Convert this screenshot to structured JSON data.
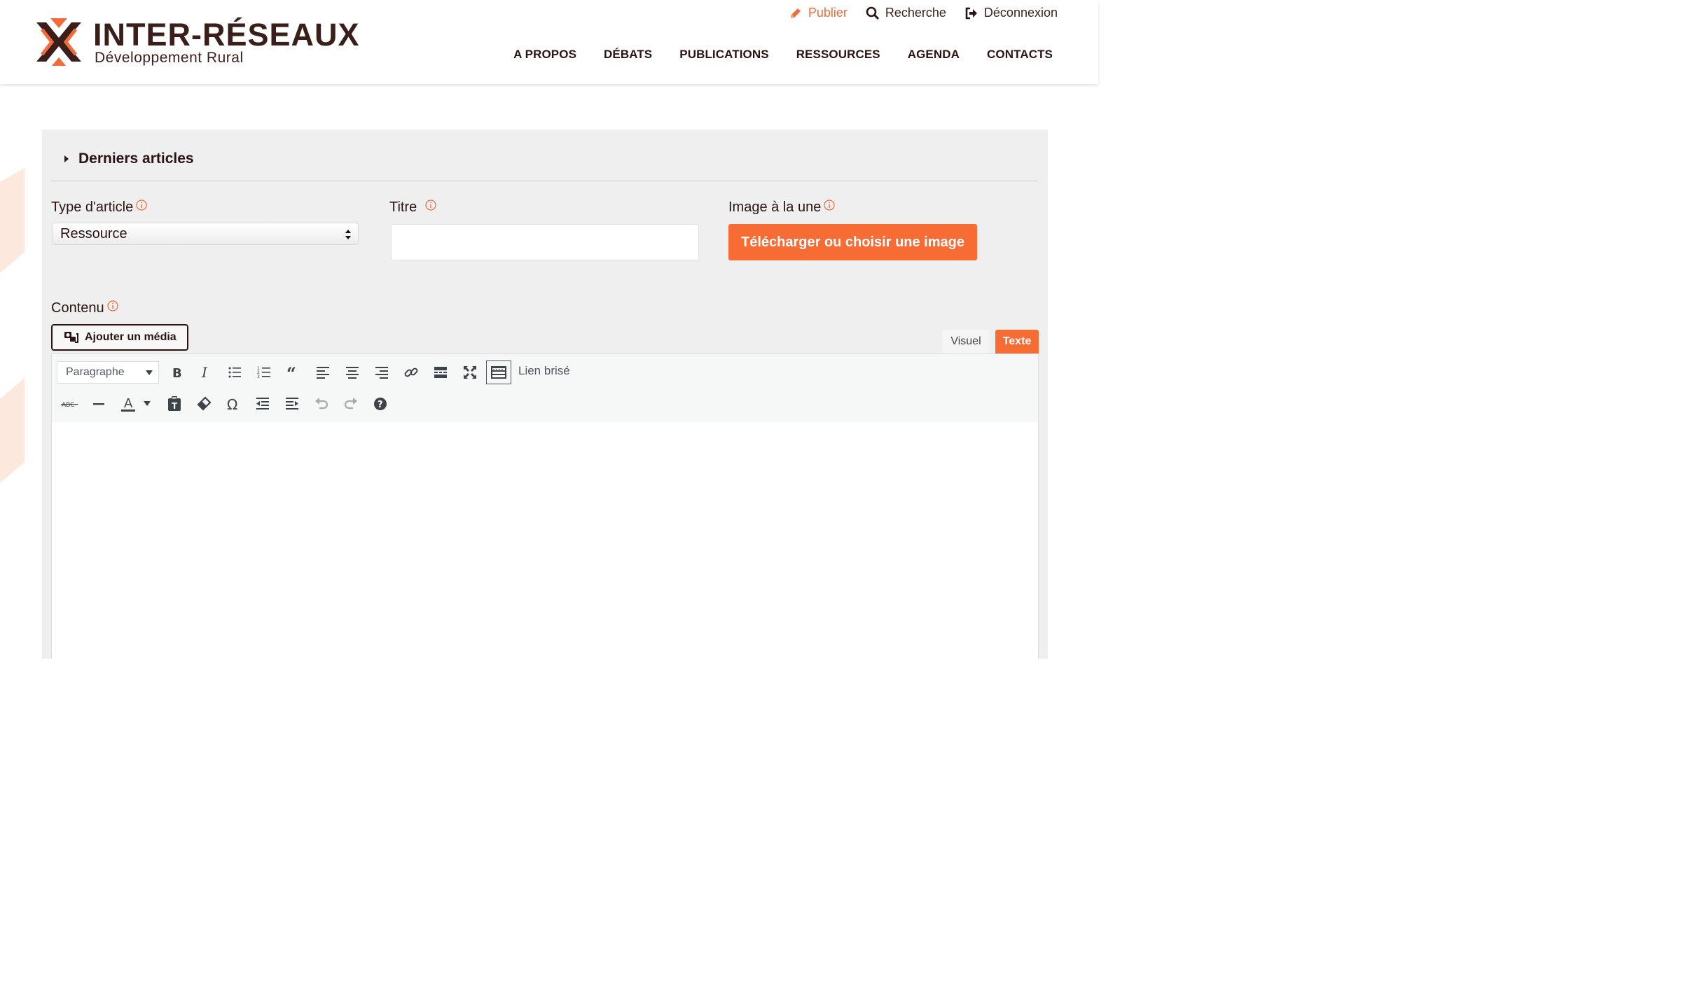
{
  "brand": {
    "title": "INTER-RÉSEAUX",
    "subtitle": "Développement Rural",
    "colors": {
      "accent": "#f76b35",
      "dark": "#3a1e19"
    }
  },
  "topbar": {
    "publish_label": "Publier",
    "search_label": "Recherche",
    "logout_label": "Déconnexion"
  },
  "nav": {
    "items": [
      {
        "label": "A PROPOS"
      },
      {
        "label": "DÉBATS"
      },
      {
        "label": "PUBLICATIONS"
      },
      {
        "label": "RESSOURCES"
      },
      {
        "label": "AGENDA"
      },
      {
        "label": "CONTACTS"
      }
    ]
  },
  "form": {
    "section_title": "Derniers articles",
    "type_label": "Type d'article",
    "type_value": "Ressource",
    "title_label": "Titre",
    "title_value": "",
    "image_label": "Image à la une",
    "upload_button": "Télécharger ou choisir une image",
    "content_label": "Contenu",
    "add_media_button": "Ajouter un média"
  },
  "editor": {
    "tabs": {
      "visual": "Visuel",
      "text": "Texte",
      "active": "text"
    },
    "format_select": "Paragraphe",
    "broken_link_label": "Lien brisé",
    "toolbar_row1_icons": [
      "bold-icon",
      "italic-icon",
      "bullet-list-icon",
      "numbered-list-icon",
      "blockquote-icon",
      "align-left-icon",
      "align-center-icon",
      "align-right-icon",
      "link-icon",
      "read-more-icon",
      "fullscreen-icon",
      "toolbar-toggle-icon"
    ],
    "toolbar_row2_icons": [
      "strikethrough-icon",
      "horizontal-line-icon",
      "text-color-icon",
      "paste-text-icon",
      "clear-formatting-icon",
      "special-character-icon",
      "outdent-icon",
      "indent-icon",
      "undo-icon",
      "redo-icon",
      "help-icon"
    ]
  }
}
